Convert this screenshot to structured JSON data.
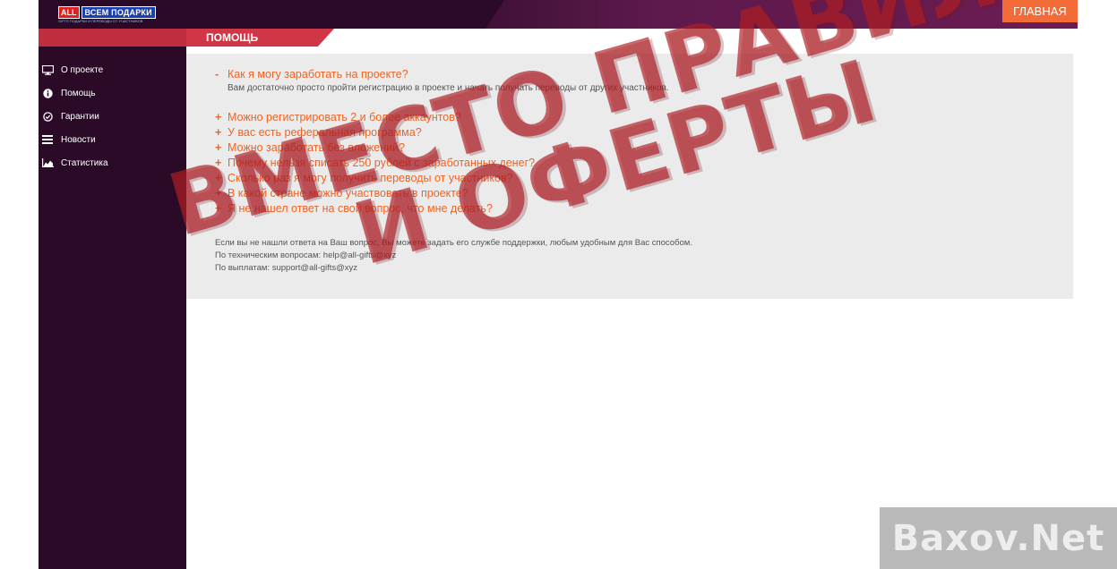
{
  "header": {
    "logo_all": "ALL",
    "logo_main": "ВСЕМ ПОДАРКИ",
    "logo_sub": "GIFTS ПОДАРКИ И ПЕРЕВОДЫ ОТ УЧАСТНИКОВ",
    "home_label": "ГЛАВНАЯ"
  },
  "tab": {
    "label": "ПОМОЩЬ"
  },
  "sidebar": {
    "items": [
      {
        "label": "О проекте",
        "icon": "monitor-icon"
      },
      {
        "label": "Помощь",
        "icon": "info-icon"
      },
      {
        "label": "Гарантии",
        "icon": "check-circle-icon"
      },
      {
        "label": "Новости",
        "icon": "list-icon"
      },
      {
        "label": "Статистика",
        "icon": "chart-icon"
      }
    ]
  },
  "faq": {
    "open": {
      "sign": "-",
      "question": "Как я могу заработать на проекте?",
      "answer": "Вам достаточно просто пройти регистрацию в проекте и начать получать переводы от других участников."
    },
    "items": [
      {
        "sign": "+",
        "question": "Можно регистрировать 2 и более аккаунтов?"
      },
      {
        "sign": "+",
        "question": "У вас есть реферальная программа?"
      },
      {
        "sign": "+",
        "question": "Можно заработать без вложений?"
      },
      {
        "sign": "+",
        "question": "Почему нельзя списать 250 рублей с заработанных денег?"
      },
      {
        "sign": "+",
        "question": "Сколько раз я могу получить переводы от участников?"
      },
      {
        "sign": "+",
        "question": "В какой стране можно участвовать в проекте?"
      },
      {
        "sign": "+",
        "question": "Я не нашел ответ на свой вопрос, что мне делать?"
      }
    ]
  },
  "contact": {
    "intro": "Если вы не нашли ответа на Ваш вопрос, Вы можете задать его службе поддержки, любым удобным для Вас способом.",
    "tech_label": "По техническим вопросам: ",
    "tech_email": "help@all-gifts@xyz",
    "pay_label": "По выплатам: ",
    "pay_email": "support@all-gifts@xyz"
  },
  "stamp": {
    "line1": "ВМЕСТО ПРАВИЛ",
    "line2": "И ОФЕРТЫ"
  },
  "watermark": {
    "text": "Baxov.Net"
  },
  "colors": {
    "accent": "#ef6424",
    "sidebar": "#2a0a27",
    "tab": "#cf3646",
    "home": "#f36c38"
  }
}
